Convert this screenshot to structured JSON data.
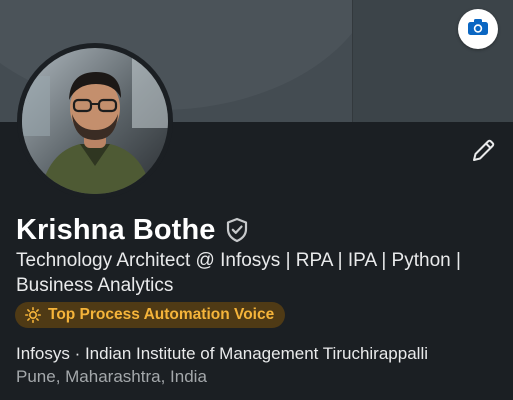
{
  "profile": {
    "name": "Krishna Bothe",
    "headline": "Technology Architect @ Infosys | RPA | IPA | Python | Business Analytics",
    "voice_badge": "Top Process Automation Voice",
    "education_line": "Infosys · Indian Institute of Management Tiruchirappalli",
    "location": "Pune, Maharashtra, India"
  },
  "icons": {
    "camera": "camera-icon",
    "edit": "pencil-icon",
    "verified": "verified-shield-icon",
    "voice": "sun-icon"
  },
  "colors": {
    "background": "#1b1f23",
    "badge_background": "#4f3a15",
    "badge_text": "#f5b43a",
    "camera_accent": "#0a66c2"
  }
}
